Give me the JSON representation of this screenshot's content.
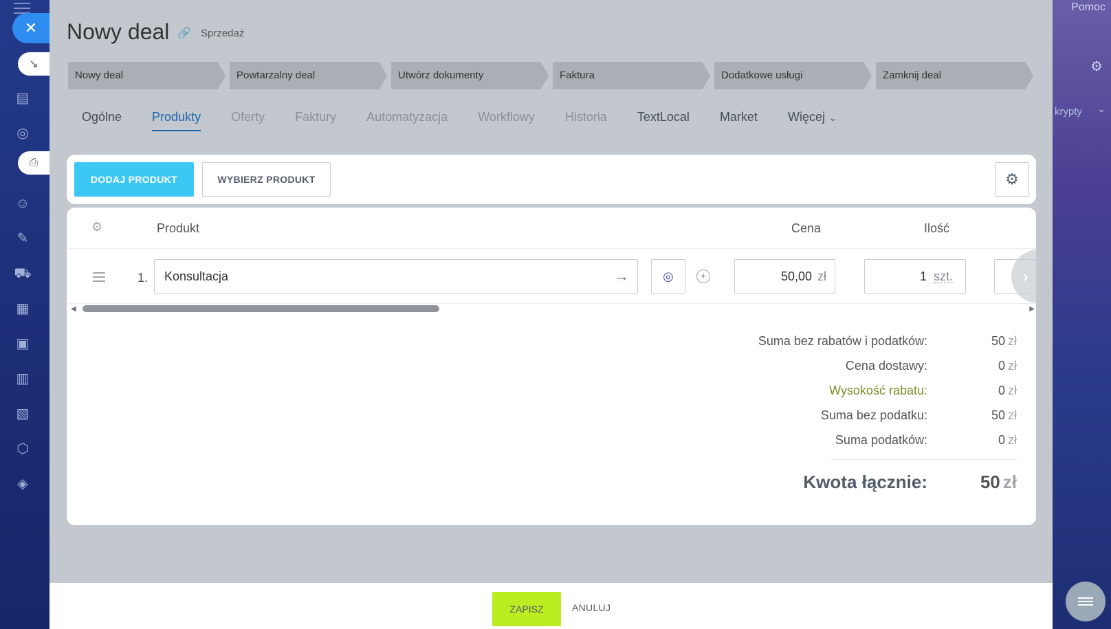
{
  "header": {
    "title": "Nowy deal",
    "subtitle": "Sprzedaż",
    "help": "Pomoc",
    "right_partial": "krypty"
  },
  "stages": [
    {
      "label": "Nowy deal"
    },
    {
      "label": "Powtarzalny deal"
    },
    {
      "label": "Utwórz dokumenty"
    },
    {
      "label": "Faktura"
    },
    {
      "label": "Dodatkowe usługi"
    },
    {
      "label": "Zamknij deal"
    }
  ],
  "tabs": [
    {
      "label": "Ogólne"
    },
    {
      "label": "Produkty"
    },
    {
      "label": "Oferty"
    },
    {
      "label": "Faktury"
    },
    {
      "label": "Automatyzacja"
    },
    {
      "label": "Workflowy"
    },
    {
      "label": "Historia"
    },
    {
      "label": "TextLocal"
    },
    {
      "label": "Market"
    },
    {
      "label": "Więcej"
    }
  ],
  "toolbar": {
    "add_label": "DODAJ PRODUKT",
    "choose_label": "WYBIERZ PRODUKT"
  },
  "table": {
    "col_product": "Produkt",
    "col_price": "Cena",
    "col_qty": "Ilość",
    "rows": [
      {
        "num": "1.",
        "product": "Konsultacja",
        "price": "50,00",
        "currency": "zł",
        "qty": "1",
        "unit": "szt."
      }
    ]
  },
  "totals": {
    "subtotal_label": "Suma bez rabatów i podatków:",
    "subtotal_value": "50",
    "delivery_label": "Cena dostawy:",
    "delivery_value": "0",
    "discount_label": "Wysokość rabatu:",
    "discount_value": "0",
    "without_tax_label": "Suma bez podatku:",
    "without_tax_value": "50",
    "tax_label": "Suma podatków:",
    "tax_value": "0",
    "total_label": "Kwota łącznie:",
    "total_value": "50",
    "currency": "zł"
  },
  "footer": {
    "save_label": "ZAPISZ",
    "cancel_label": "ANULUJ"
  },
  "colors": {
    "accent": "#3bc8f5",
    "save": "#bbed21",
    "active_tab": "#2067b0",
    "close": "#2f8cf0"
  }
}
